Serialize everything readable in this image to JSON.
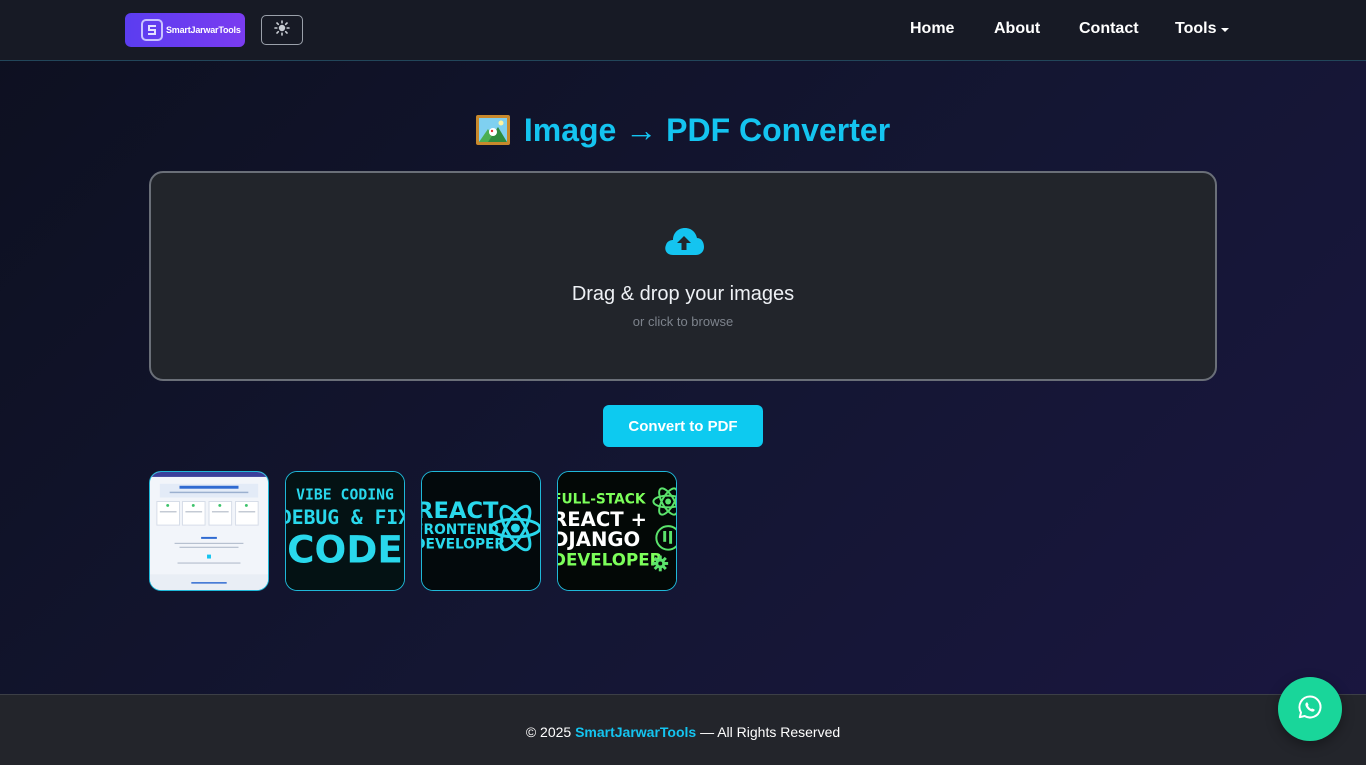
{
  "navbar": {
    "brand": "SmartJarwarTools",
    "theme_toggle_icon": "sun-icon",
    "links": [
      "Home",
      "About",
      "Contact",
      "Tools"
    ]
  },
  "page": {
    "title": "Image → PDF Converter",
    "title_icon": "framed-picture-icon"
  },
  "dropzone": {
    "icon": "cloud-upload-icon",
    "title": "Drag & drop your images",
    "subtitle": "or click to browse"
  },
  "convert_button": "Convert to PDF",
  "thumbnails": [
    {
      "caption_lines": []
    },
    {
      "caption_lines": [
        "VIBE CODING",
        "DEBUG & FIX",
        "CODE"
      ]
    },
    {
      "caption_lines": [
        "REACT",
        "FRONTEND",
        "DEVELOPER"
      ]
    },
    {
      "caption_lines": [
        "FULL-STACK",
        "REACT +",
        "DJANGO",
        "DEVELOPER"
      ]
    }
  ],
  "footer": {
    "prefix": "© 2025 ",
    "brand": "SmartJarwarTools",
    "suffix": " — All Rights Reserved"
  },
  "floating": {
    "icon": "whatsapp-icon"
  },
  "colors": {
    "accent": "#0dcaf0",
    "brand_bg": "#5b3df0",
    "whatsapp": "#19d69a",
    "neon_green": "#7cff5a"
  }
}
